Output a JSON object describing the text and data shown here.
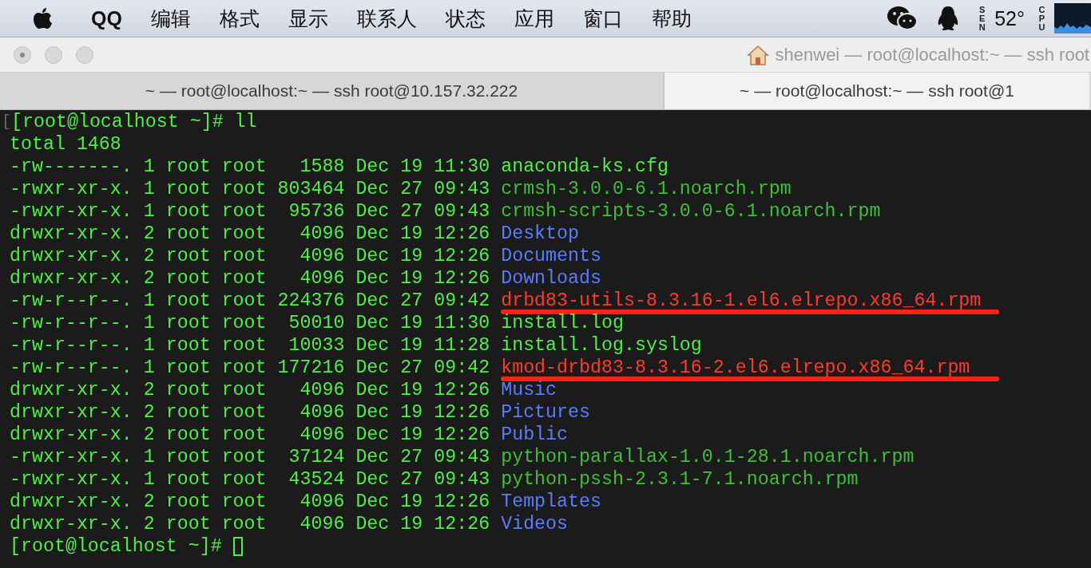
{
  "menu_bar": {
    "app_name": "QQ",
    "items": [
      "编辑",
      "格式",
      "显示",
      "联系人",
      "状态",
      "应用",
      "窗口",
      "帮助"
    ],
    "sensor_label": "SEN",
    "temperature": "52°",
    "cpu_label": "CPU"
  },
  "window": {
    "title": "shenwei — root@localhost:~ — ssh root"
  },
  "tabs": [
    {
      "label": "~ — root@localhost:~ — ssh root@10.157.32.222",
      "selected": false
    },
    {
      "label": "~ — root@localhost:~ — ssh root@1",
      "selected": true
    }
  ],
  "terminal": {
    "prompt_marker": "[",
    "command_line": "[root@localhost ~]# ll",
    "total": "total 1468",
    "files": [
      {
        "details": "-rw-------. 1 root root   1588 Dec 19 11:30",
        "name": "anaconda-ks.cfg",
        "kind": "file",
        "underlined": false
      },
      {
        "details": "-rwxr-xr-x. 1 root root 803464 Dec 27 09:43",
        "name": "crmsh-3.0.0-6.1.noarch.rpm",
        "kind": "package",
        "underlined": false
      },
      {
        "details": "-rwxr-xr-x. 1 root root  95736 Dec 27 09:43",
        "name": "crmsh-scripts-3.0.0-6.1.noarch.rpm",
        "kind": "package",
        "underlined": false
      },
      {
        "details": "drwxr-xr-x. 2 root root   4096 Dec 19 12:26",
        "name": "Desktop",
        "kind": "directory",
        "underlined": false
      },
      {
        "details": "drwxr-xr-x. 2 root root   4096 Dec 19 12:26",
        "name": "Documents",
        "kind": "directory",
        "underlined": false
      },
      {
        "details": "drwxr-xr-x. 2 root root   4096 Dec 19 12:26",
        "name": "Downloads",
        "kind": "directory",
        "underlined": false
      },
      {
        "details": "-rw-r--r--. 1 root root 224376 Dec 27 09:42",
        "name": "drbd83-utils-8.3.16-1.el6.elrepo.x86_64.rpm",
        "kind": "highlighted",
        "underlined": true
      },
      {
        "details": "-rw-r--r--. 1 root root  50010 Dec 19 11:30",
        "name": "install.log",
        "kind": "file",
        "underlined": false
      },
      {
        "details": "-rw-r--r--. 1 root root  10033 Dec 19 11:28",
        "name": "install.log.syslog",
        "kind": "file",
        "underlined": false
      },
      {
        "details": "-rw-r--r--. 1 root root 177216 Dec 27 09:42",
        "name": "kmod-drbd83-8.3.16-2.el6.elrepo.x86_64.rpm",
        "kind": "highlighted",
        "underlined": true
      },
      {
        "details": "drwxr-xr-x. 2 root root   4096 Dec 19 12:26",
        "name": "Music",
        "kind": "directory",
        "underlined": false
      },
      {
        "details": "drwxr-xr-x. 2 root root   4096 Dec 19 12:26",
        "name": "Pictures",
        "kind": "directory",
        "underlined": false
      },
      {
        "details": "drwxr-xr-x. 2 root root   4096 Dec 19 12:26",
        "name": "Public",
        "kind": "directory",
        "underlined": false
      },
      {
        "details": "-rwxr-xr-x. 1 root root  37124 Dec 27 09:43",
        "name": "python-parallax-1.0.1-28.1.noarch.rpm",
        "kind": "package",
        "underlined": false
      },
      {
        "details": "-rwxr-xr-x. 1 root root  43524 Dec 27 09:43",
        "name": "python-pssh-2.3.1-7.1.noarch.rpm",
        "kind": "package",
        "underlined": false
      },
      {
        "details": "drwxr-xr-x. 2 root root   4096 Dec 19 12:26",
        "name": "Templates",
        "kind": "directory",
        "underlined": false
      },
      {
        "details": "drwxr-xr-x. 2 root root   4096 Dec 19 12:26",
        "name": "Videos",
        "kind": "directory",
        "underlined": false
      }
    ],
    "prompt": "[root@localhost ~]#"
  }
}
